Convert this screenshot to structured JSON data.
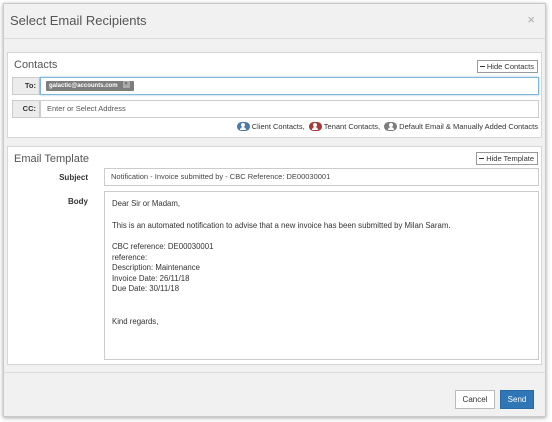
{
  "dialog": {
    "title": "Select Email Recipients",
    "close_label": "×"
  },
  "contacts": {
    "title": "Contacts",
    "hide_label": "Hide Contacts",
    "to_label": "To:",
    "to_chip": "galactic@accounts.com",
    "chip_remove": "×",
    "cc_label": "CC:",
    "cc_placeholder": "Enter or Select Address",
    "legend": [
      {
        "label": "Client Contacts,",
        "color": "#4a7aa6",
        "icon": "person-icon"
      },
      {
        "label": "Tenant Contacts,",
        "color": "#a43a3a",
        "icon": "person-icon"
      },
      {
        "label": "Default Email & Manually Added Contacts",
        "color": "#7d7d7d",
        "icon": "person-icon"
      }
    ]
  },
  "template": {
    "title": "Email Template",
    "hide_label": "Hide Template",
    "subject_label": "Subject",
    "subject_value": "Notification - Invoice submitted by - CBC Reference: DE00030001",
    "body_label": "Body",
    "body": {
      "greeting": "Dear Sir or Madam,",
      "intro": "This is an automated notification to advise that a new invoice has been submitted by Milan Saram.",
      "line1": "CBC reference: DE00030001",
      "line2": "reference:",
      "line3": "Description: Maintenance",
      "line4": "Invoice Date: 26/11/18",
      "line5": "Due Date: 30/11/18",
      "closing": "Kind regards,"
    }
  },
  "footer": {
    "cancel_label": "Cancel",
    "send_label": "Send"
  },
  "colors": {
    "accent": "#2e76b6",
    "client": "#4a7aa6",
    "tenant": "#a43a3a",
    "default": "#7d7d7d"
  }
}
